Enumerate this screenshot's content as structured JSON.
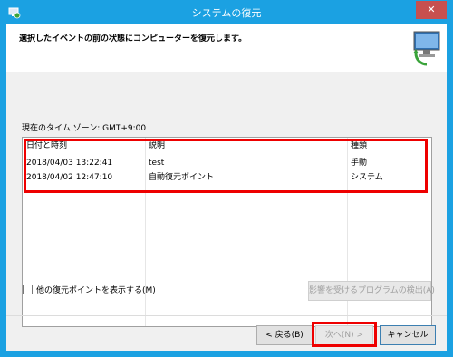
{
  "window": {
    "title": "システムの復元",
    "close_glyph": "✕"
  },
  "header": {
    "instruction": "選択したイベントの前の状態にコンピューターを復元します。"
  },
  "timezone": {
    "label": "現在のタイム ゾーン: GMT+9:00"
  },
  "table": {
    "headers": [
      "日付と時刻",
      "説明",
      "種類"
    ],
    "rows": [
      [
        "2018/04/03 13:22:41",
        "test",
        "手動"
      ],
      [
        "2018/04/02 12:47:10",
        "自動復元ポイント",
        "システム"
      ]
    ]
  },
  "options": {
    "show_more_label": "他の復元ポイントを表示する(M)",
    "show_more_checked": false
  },
  "buttons": {
    "scan": "影響を受けるプログラムの検出(A)",
    "back": "< 戻る(B)",
    "next": "次へ(N) >",
    "cancel": "キャンセル"
  },
  "colors": {
    "accent": "#1ba1e2",
    "highlight": "#e00000",
    "close": "#c7504f"
  },
  "icons": {
    "app": "system-restore-icon",
    "hero": "computer-restore-icon"
  }
}
